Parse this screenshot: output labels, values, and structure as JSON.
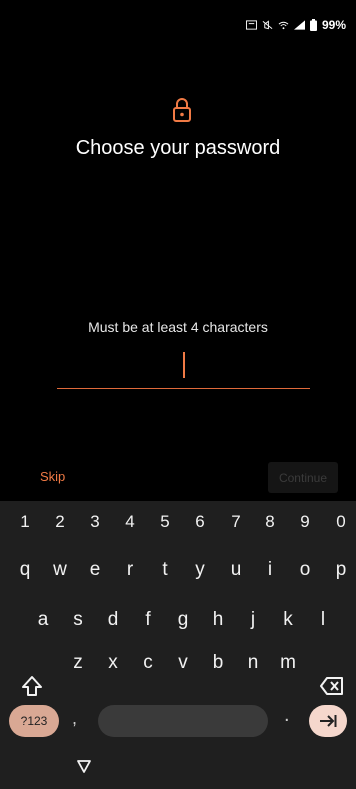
{
  "status_bar": {
    "battery_percent": "99%",
    "icons": [
      "nfc-icon",
      "mute-icon",
      "wifi-icon",
      "signal-icon",
      "battery-icon"
    ]
  },
  "header": {
    "icon": "lock-icon",
    "title": "Choose your password"
  },
  "password": {
    "hint": "Must be at least 4 characters",
    "value": ""
  },
  "actions": {
    "skip_label": "Skip",
    "continue_label": "Continue"
  },
  "keyboard": {
    "number_row": [
      "1",
      "2",
      "3",
      "4",
      "5",
      "6",
      "7",
      "8",
      "9",
      "0"
    ],
    "row1": [
      "q",
      "w",
      "e",
      "r",
      "t",
      "y",
      "u",
      "i",
      "o",
      "p"
    ],
    "row2": [
      "a",
      "s",
      "d",
      "f",
      "g",
      "h",
      "j",
      "k",
      "l"
    ],
    "row3": [
      "z",
      "x",
      "c",
      "v",
      "b",
      "n",
      "m"
    ],
    "symbols_label": "?123",
    "comma": ",",
    "period": ".",
    "enter_icon": "enter-arrow-icon",
    "shift_icon": "shift-icon",
    "backspace_icon": "backspace-icon"
  },
  "colors": {
    "accent": "#f07a45",
    "background": "#000000",
    "keyboard_bg": "#1f1f1f"
  }
}
